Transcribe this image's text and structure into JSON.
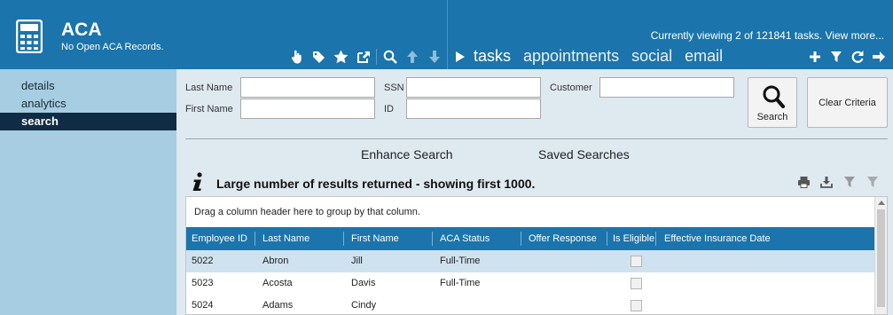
{
  "app": {
    "title": "ACA",
    "subtitle": "No Open ACA Records.",
    "viewing_text": "Currently viewing 2 of 121841 tasks. View more..."
  },
  "toolbar_icons": [
    "hand-pointer-icon",
    "tag-icon",
    "star-icon",
    "external-link-icon",
    "search-icon",
    "arrow-up-icon",
    "arrow-down-icon"
  ],
  "nav_tabs": [
    {
      "label": "tasks"
    },
    {
      "label": "appointments"
    },
    {
      "label": "social"
    },
    {
      "label": "email"
    }
  ],
  "header_actions": [
    "plus-icon",
    "filter-icon",
    "refresh-icon",
    "arrow-right-icon"
  ],
  "sidebar": {
    "items": [
      {
        "label": "details",
        "active": false
      },
      {
        "label": "analytics",
        "active": false
      },
      {
        "label": "search",
        "active": true
      }
    ]
  },
  "search_form": {
    "last_name_label": "Last Name",
    "first_name_label": "First Name",
    "ssn_label": "SSN",
    "id_label": "ID",
    "customer_label": "Customer",
    "last_name_value": "",
    "first_name_value": "",
    "ssn_value": "",
    "id_value": "",
    "customer_value": "",
    "search_button": "Search",
    "clear_button": "Clear Criteria"
  },
  "links": {
    "enhance_search": "Enhance Search",
    "saved_searches": "Saved Searches"
  },
  "info_message": "Large number of results returned - showing first 1000.",
  "grid": {
    "group_hint": "Drag a column header here to group by that column.",
    "columns": [
      "Employee ID",
      "Last Name",
      "First Name",
      "ACA Status",
      "Offer Response",
      "Is Eligible",
      "Effective Insurance Date"
    ],
    "rows": [
      {
        "employee_id": "5022",
        "last_name": "Abron",
        "first_name": "Jill",
        "aca_status": "Full-Time",
        "offer_response": "",
        "is_eligible": false,
        "effective_date": ""
      },
      {
        "employee_id": "5023",
        "last_name": "Acosta",
        "first_name": "Davis",
        "aca_status": "Full-Time",
        "offer_response": "",
        "is_eligible": false,
        "effective_date": ""
      },
      {
        "employee_id": "5024",
        "last_name": "Adams",
        "first_name": "Cindy",
        "aca_status": "",
        "offer_response": "",
        "is_eligible": false,
        "effective_date": ""
      }
    ]
  },
  "colors": {
    "header_bg": "#1b74ab",
    "sidebar_bg": "#a6cde1",
    "sidebar_active": "#0f2c44",
    "content_bg": "#dfe9f0",
    "row_alt": "#cfe2ef"
  }
}
